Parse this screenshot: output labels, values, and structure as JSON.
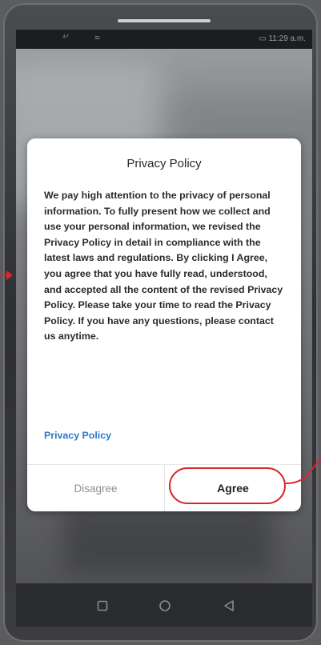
{
  "status_bar": {
    "signal": "⁴ᐟ",
    "wifi": "≈",
    "battery_time": "▭ 11:29 a.m."
  },
  "dialog": {
    "title": "Privacy Policy",
    "body": "We pay high attention to the privacy of personal information. To fully present how we collect and use your personal information, we revised the Privacy Policy in detail in compliance with the latest laws and regulations. By clicking I Agree, you agree that you have fully read, understood, and accepted all the content of the revised Privacy Policy. Please take your time to read the Privacy Policy. If you have any questions, please contact us anytime.",
    "link_label": "Privacy Policy",
    "disagree_label": "Disagree",
    "agree_label": "Agree"
  },
  "colors": {
    "link": "#2a77c9",
    "highlight": "#d9262c",
    "disagree_text": "#8e8e8e"
  },
  "icons": {
    "nav_recent": "square-icon",
    "nav_home": "circle-icon",
    "nav_back": "triangle-back-icon"
  }
}
